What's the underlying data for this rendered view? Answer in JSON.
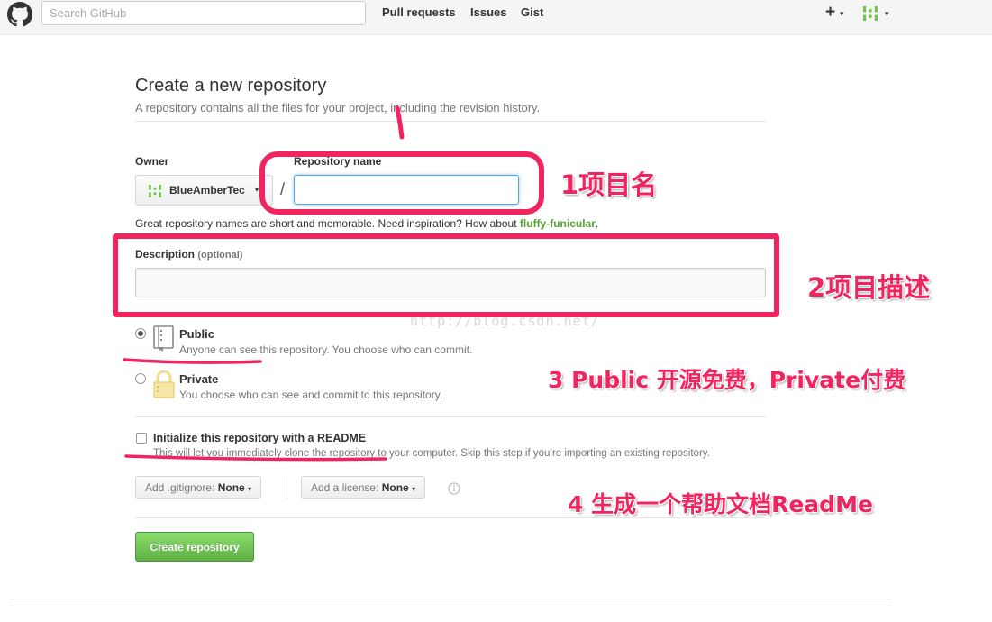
{
  "header": {
    "logo_icon": "github-octocat-icon",
    "search_placeholder": "Search GitHub",
    "nav": [
      "Pull requests",
      "Issues",
      "Gist"
    ],
    "plus_icon": "+",
    "caret": "▾",
    "avatar_icon": "identicon-icon"
  },
  "form": {
    "title": "Create a new repository",
    "subtitle": "A repository contains all the files for your project, including the revision history.",
    "owner_label": "Owner",
    "owner_value": "BlueAmberTec",
    "slash": "/",
    "repo_name_label": "Repository name",
    "repo_name_value": "",
    "hint_prefix": "Great repository names are short and memorable. Need inspiration? How about",
    "hint_suggestion": "fluffy-funicular",
    "hint_suffix": ".",
    "description_label": "Description",
    "description_optional": "(optional)",
    "description_value": "",
    "visibility": {
      "selected": "public",
      "public_title": "Public",
      "public_desc": "Anyone can see this repository. You choose who can commit.",
      "private_title": "Private",
      "private_desc": "You choose who can see and commit to this repository."
    },
    "readme": {
      "checked": false,
      "title": "Initialize this repository with a README",
      "desc": "This will let you immediately clone the repository to your computer. Skip this step if you’re importing an existing repository."
    },
    "gitignore_label": "Add .gitignore:",
    "gitignore_value": "None",
    "license_label": "Add a license:",
    "license_value": "None",
    "submit_label": "Create repository"
  },
  "watermark": "http://blog.csdn.net/",
  "annotations": {
    "color": "#f0245f",
    "a1": "1项目名",
    "a2": "2项目描述",
    "a3": "3 Public 开源免费，Private付费",
    "a4": "4 生成一个帮助文档ReadMe"
  }
}
